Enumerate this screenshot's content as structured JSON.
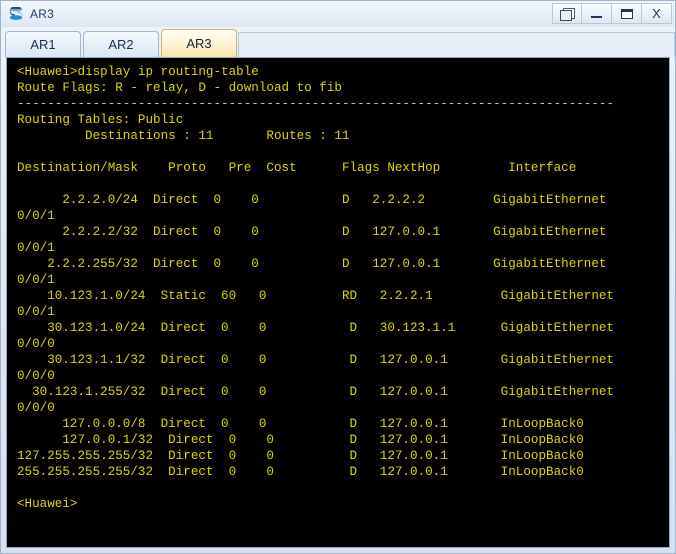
{
  "window": {
    "title": "AR3",
    "icon": "ensp-router-icon",
    "controls": [
      {
        "name": "restore-windows-button",
        "label": "",
        "glyph": "cascade-icon"
      },
      {
        "name": "minimize-button",
        "label": "",
        "glyph": "minimize-icon"
      },
      {
        "name": "maximize-button",
        "label": "",
        "glyph": "maximize-icon"
      },
      {
        "name": "close-button",
        "label": "X",
        "glyph": "close-icon"
      }
    ]
  },
  "tabs": [
    {
      "label": "AR1",
      "active": false
    },
    {
      "label": "AR2",
      "active": false
    },
    {
      "label": "AR3",
      "active": true
    }
  ],
  "terminal": {
    "colors": {
      "background": "#000000",
      "foreground": "#d8d800"
    },
    "prompt_device": "Huawei",
    "command": "display ip routing-table",
    "lines": [
      "<Huawei>display ip routing-table",
      "Route Flags: R - relay, D - download to fib",
      "-------------------------------------------------------------------------------",
      "Routing Tables: Public",
      "         Destinations : 11       Routes : 11",
      "",
      "Destination/Mask    Proto   Pre  Cost      Flags NextHop         Interface",
      "",
      "      2.2.2.0/24  Direct  0    0           D   2.2.2.2         GigabitEthernet",
      "0/0/1",
      "      2.2.2.2/32  Direct  0    0           D   127.0.0.1       GigabitEthernet",
      "0/0/1",
      "    2.2.2.255/32  Direct  0    0           D   127.0.0.1       GigabitEthernet",
      "0/0/1",
      "    10.123.1.0/24  Static  60   0          RD   2.2.2.1         GigabitEthernet",
      "0/0/1",
      "    30.123.1.0/24  Direct  0    0           D   30.123.1.1      GigabitEthernet",
      "0/0/0",
      "    30.123.1.1/32  Direct  0    0           D   127.0.0.1       GigabitEthernet",
      "0/0/0",
      "  30.123.1.255/32  Direct  0    0           D   127.0.0.1       GigabitEthernet",
      "0/0/0",
      "      127.0.0.0/8  Direct  0    0           D   127.0.0.1       InLoopBack0",
      "      127.0.0.1/32  Direct  0    0          D   127.0.0.1       InLoopBack0",
      "127.255.255.255/32  Direct  0    0          D   127.0.0.1       InLoopBack0",
      "255.255.255.255/32  Direct  0    0          D   127.0.0.1       InLoopBack0",
      "",
      "<Huawei>"
    ],
    "routing_table": {
      "flags_legend": "Route Flags: R - relay, D - download to fib",
      "table_name": "Routing Tables: Public",
      "destinations": "11",
      "routes": "11",
      "headers": [
        "Destination/Mask",
        "Proto",
        "Pre",
        "Cost",
        "Flags",
        "NextHop",
        "Interface"
      ],
      "rows": [
        {
          "destination": "2.2.2.0/24",
          "proto": "Direct",
          "pre": "0",
          "cost": "0",
          "flags": "D",
          "nexthop": "2.2.2.2",
          "interface": "GigabitEthernet0/0/1"
        },
        {
          "destination": "2.2.2.2/32",
          "proto": "Direct",
          "pre": "0",
          "cost": "0",
          "flags": "D",
          "nexthop": "127.0.0.1",
          "interface": "GigabitEthernet0/0/1"
        },
        {
          "destination": "2.2.2.255/32",
          "proto": "Direct",
          "pre": "0",
          "cost": "0",
          "flags": "D",
          "nexthop": "127.0.0.1",
          "interface": "GigabitEthernet0/0/1"
        },
        {
          "destination": "10.123.1.0/24",
          "proto": "Static",
          "pre": "60",
          "cost": "0",
          "flags": "RD",
          "nexthop": "2.2.2.1",
          "interface": "GigabitEthernet0/0/1"
        },
        {
          "destination": "30.123.1.0/24",
          "proto": "Direct",
          "pre": "0",
          "cost": "0",
          "flags": "D",
          "nexthop": "30.123.1.1",
          "interface": "GigabitEthernet0/0/0"
        },
        {
          "destination": "30.123.1.1/32",
          "proto": "Direct",
          "pre": "0",
          "cost": "0",
          "flags": "D",
          "nexthop": "127.0.0.1",
          "interface": "GigabitEthernet0/0/0"
        },
        {
          "destination": "30.123.1.255/32",
          "proto": "Direct",
          "pre": "0",
          "cost": "0",
          "flags": "D",
          "nexthop": "127.0.0.1",
          "interface": "GigabitEthernet0/0/0"
        },
        {
          "destination": "127.0.0.0/8",
          "proto": "Direct",
          "pre": "0",
          "cost": "0",
          "flags": "D",
          "nexthop": "127.0.0.1",
          "interface": "InLoopBack0"
        },
        {
          "destination": "127.0.0.1/32",
          "proto": "Direct",
          "pre": "0",
          "cost": "0",
          "flags": "D",
          "nexthop": "127.0.0.1",
          "interface": "InLoopBack0"
        },
        {
          "destination": "127.255.255.255/32",
          "proto": "Direct",
          "pre": "0",
          "cost": "0",
          "flags": "D",
          "nexthop": "127.0.0.1",
          "interface": "InLoopBack0"
        },
        {
          "destination": "255.255.255.255/32",
          "proto": "Direct",
          "pre": "0",
          "cost": "0",
          "flags": "D",
          "nexthop": "127.0.0.1",
          "interface": "InLoopBack0"
        }
      ]
    }
  }
}
